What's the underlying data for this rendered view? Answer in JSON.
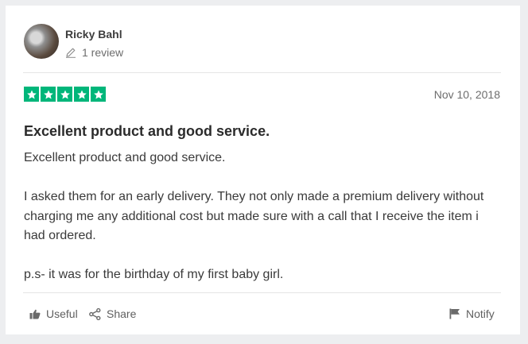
{
  "reviewer": {
    "name": "Ricky Bahl",
    "review_count": "1 review",
    "avatar_icon": "user-avatar-photo"
  },
  "rating": {
    "stars": 5,
    "max": 5,
    "color": "#00b67a"
  },
  "date": "Nov 10, 2018",
  "review": {
    "title": "Excellent product and good service.",
    "paragraphs": [
      "Excellent product and good service.",
      "I asked them for an early delivery. They not only made a premium delivery without charging me any additional cost but made sure with a call that I receive the item i had ordered.",
      "p.s- it was for the birthday of my first baby girl."
    ]
  },
  "actions": {
    "useful_label": "Useful",
    "share_label": "Share",
    "notify_label": "Notify"
  }
}
